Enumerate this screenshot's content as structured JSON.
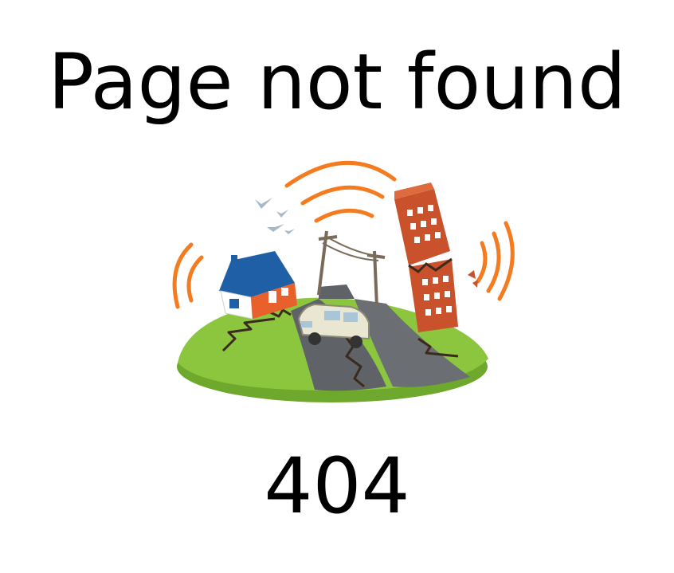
{
  "page": {
    "title": "Page not found",
    "code": "404"
  },
  "illustration": {
    "icon": "earthquake-illustration",
    "colors": {
      "grass": "#8cc63f",
      "grass_edge": "#6ea82c",
      "road": "#5f6368",
      "crack": "#3b2a1e",
      "waves": "#f47b20",
      "house_roof": "#1f5fa6",
      "house_wall": "#ffffff",
      "house_side": "#e8602c",
      "building": "#c9512b",
      "car": "#e9e6d2",
      "birds": "#a7b8c9"
    }
  }
}
